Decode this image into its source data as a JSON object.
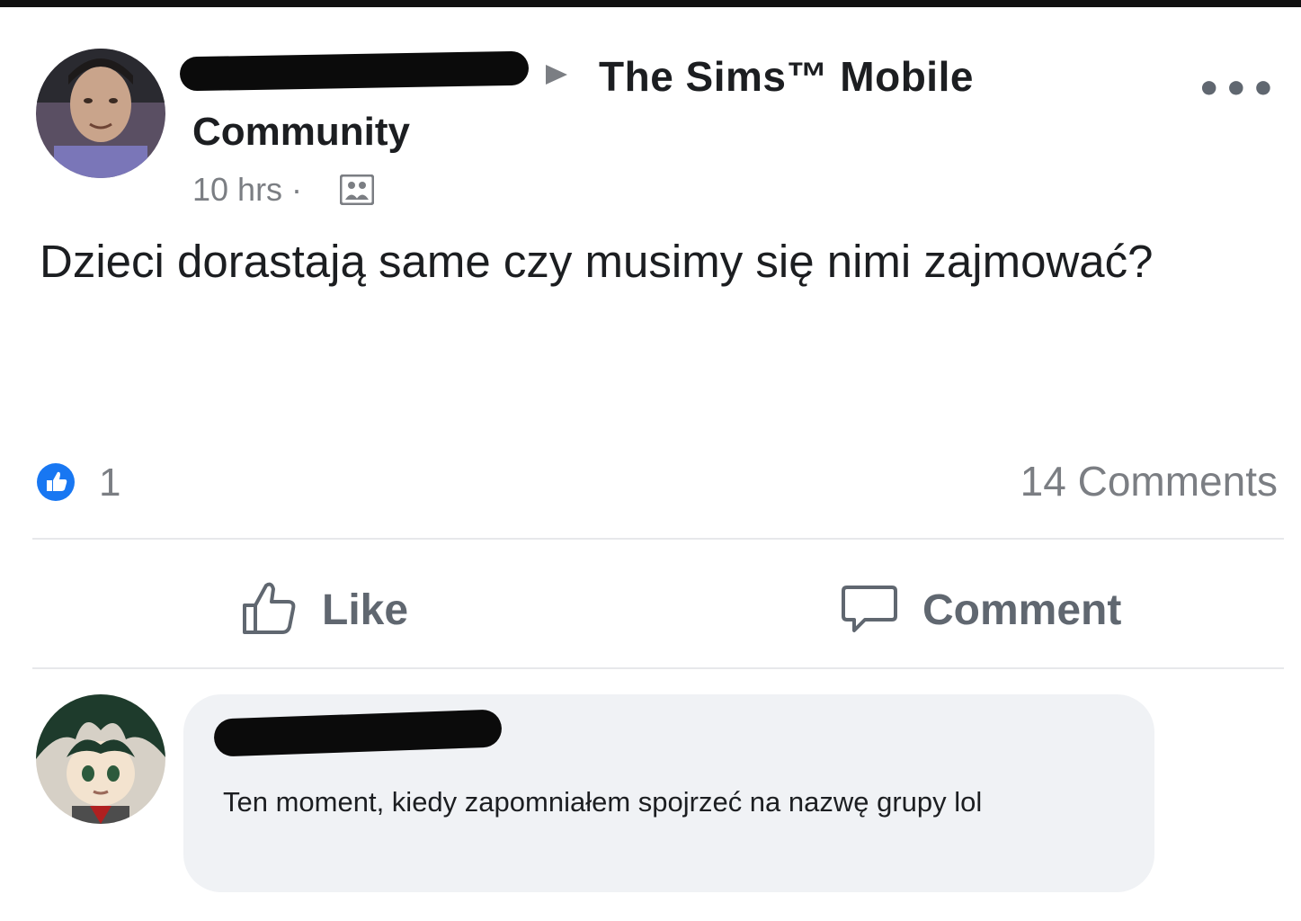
{
  "post": {
    "group_name_line1": "The Sims™ Mobile",
    "group_name_line2": "Community",
    "time": "10 hrs ·",
    "more_label": "•••",
    "text": "Dzieci dorastają same czy musimy się nimi zajmować?",
    "like_count": "1",
    "comments_count": "14 Comments"
  },
  "actions": {
    "like_label": "Like",
    "comment_label": "Comment"
  },
  "comment": {
    "text": "Ten moment, kiedy zapomniałem spojrzeć na nazwę grupy lol"
  },
  "colors": {
    "accent": "#1877f2",
    "secondary_text": "#7b7e83",
    "bubble": "#f0f2f5"
  },
  "icons": {
    "group": "group-icon",
    "like_badge": "like-badge-icon",
    "like": "thumbs-up-icon",
    "comment": "speech-bubble-icon",
    "more": "more-icon"
  }
}
